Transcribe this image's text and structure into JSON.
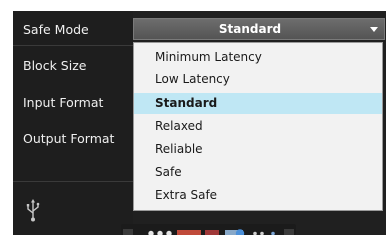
{
  "labels": {
    "safe_mode": "Safe Mode",
    "block_size": "Block Size",
    "input_format": "Input Format",
    "output_format": "Output Format"
  },
  "safe_mode_select": {
    "value": "Standard",
    "options": [
      {
        "label": "Minimum Latency",
        "selected": false
      },
      {
        "label": "Low Latency",
        "selected": false
      },
      {
        "label": "Standard",
        "selected": true
      },
      {
        "label": "Relaxed",
        "selected": false
      },
      {
        "label": "Reliable",
        "selected": false
      },
      {
        "label": "Safe",
        "selected": false
      },
      {
        "label": "Extra Safe",
        "selected": false
      }
    ]
  },
  "icons": {
    "usb": "usb-icon",
    "dropdown_arrow": "chevron-down-icon"
  },
  "colors": {
    "panel_bg": "#202020",
    "combo_bg": "#5f5f5f",
    "menu_bg": "#f2f2f2",
    "selected_bg": "#bfe7f4",
    "label_text": "#f0f0f0"
  }
}
